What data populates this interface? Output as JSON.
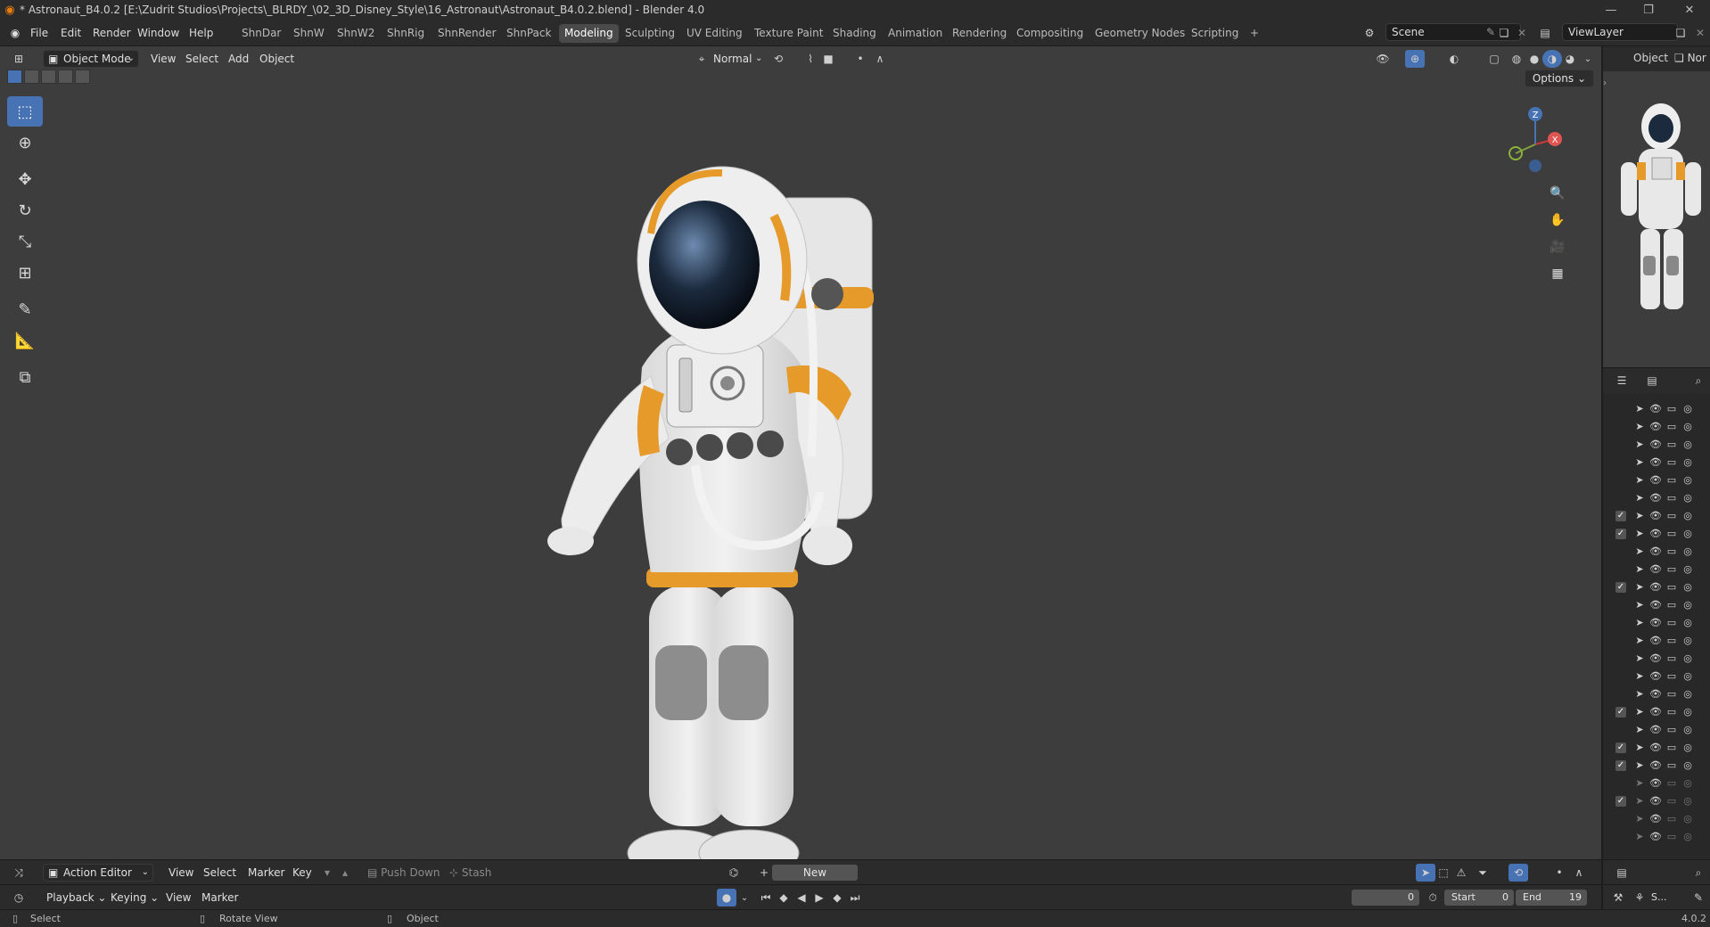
{
  "window": {
    "title": "* Astronaut_B4.0.2 [E:\\Zudrit Studios\\Projects\\_BLRDY_\\02_3D_Disney_Style\\16_Astronaut\\Astronaut_B4.0.2.blend] - Blender 4.0",
    "minimize": "—",
    "restore": "❐",
    "close": "✕"
  },
  "menu": {
    "logo": "◉",
    "items": [
      "File",
      "Edit",
      "Render",
      "Window",
      "Help"
    ]
  },
  "workspaces": {
    "tabs": [
      "ShnDar",
      "ShnW",
      "ShnW2",
      "ShnRig",
      "ShnRender",
      "ShnPack",
      "Modeling",
      "Sculpting",
      "UV Editing",
      "Texture Paint",
      "Shading",
      "Animation",
      "Rendering",
      "Compositing",
      "Geometry Nodes",
      "Scripting"
    ],
    "active": "Modeling",
    "add": "+"
  },
  "scene": {
    "label": "Scene",
    "viewlayer": "ViewLayer"
  },
  "viewport": {
    "mode": "Object Mode",
    "menus": [
      "View",
      "Select",
      "Add",
      "Object"
    ],
    "orientation": "Normal",
    "options": "Options ⌄"
  },
  "properties_panel": {
    "tab_object": "Object",
    "tab_name_partial": "Nor"
  },
  "action_editor": {
    "editor": "Action Editor",
    "menus": [
      "View",
      "Select",
      "Marker",
      "Key"
    ],
    "push_down": "Push Down",
    "stash": "Stash",
    "new_button": "New"
  },
  "timeline": {
    "menus": [
      "Playback ⌄",
      "Keying ⌄",
      "View",
      "Marker"
    ],
    "current_frame": "0",
    "start_label": "Start",
    "start_value": "0",
    "end_label": "End",
    "end_value": "19"
  },
  "status_bar": {
    "select": "Select",
    "rotate_view": "Rotate View",
    "object": "Object",
    "version": "4.0.2",
    "mini_s": "S..."
  },
  "outliner_rows": [
    {
      "check": false,
      "restrict": true
    },
    {
      "check": false,
      "restrict": true
    },
    {
      "check": false,
      "restrict": true
    },
    {
      "check": false,
      "restrict": true
    },
    {
      "check": false,
      "restrict": true
    },
    {
      "check": false,
      "restrict": true
    },
    {
      "check": true,
      "restrict": true
    },
    {
      "check": true,
      "restrict": true
    },
    {
      "check": false,
      "restrict": true
    },
    {
      "check": false,
      "restrict": true
    },
    {
      "check": true,
      "restrict": true
    },
    {
      "check": false,
      "restrict": true
    },
    {
      "check": false,
      "restrict": true
    },
    {
      "check": false,
      "restrict": true
    },
    {
      "check": false,
      "restrict": true
    },
    {
      "check": false,
      "restrict": true
    },
    {
      "check": false,
      "restrict": true
    },
    {
      "check": true,
      "restrict": true
    },
    {
      "check": false,
      "restrict": true
    },
    {
      "check": true,
      "restrict": true
    },
    {
      "check": true,
      "restrict": true
    },
    {
      "check": false,
      "restrict": false
    },
    {
      "check": true,
      "restrict": false
    },
    {
      "check": false,
      "restrict": false
    },
    {
      "check": false,
      "restrict": false
    }
  ],
  "gizmo": {
    "z": "Z",
    "x": "X"
  },
  "colors": {
    "accent": "#4772b3",
    "blender_orange": "#e87d0d",
    "suit_orange": "#e89b2b"
  }
}
